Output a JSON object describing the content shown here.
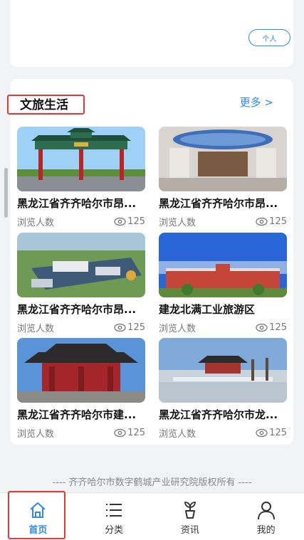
{
  "top_card": {
    "tag_label": "个人"
  },
  "section": {
    "title": "文旅生活",
    "more_label": "更多 >",
    "cards": [
      {
        "title": "黑龙江省齐齐哈尔市昂...",
        "meta_label": "浏览人数",
        "views": "125"
      },
      {
        "title": "黑龙江省齐齐哈尔市昂...",
        "meta_label": "浏览人数",
        "views": "125"
      },
      {
        "title": "黑龙江省齐齐哈尔市昂...",
        "meta_label": "浏览人数",
        "views": "125"
      },
      {
        "title": "建龙北满工业旅游区",
        "meta_label": "浏览人数",
        "views": "125"
      },
      {
        "title": "黑龙江省齐齐哈尔市建...",
        "meta_label": "浏览人数",
        "views": "125"
      },
      {
        "title": "黑龙江省齐齐哈尔市龙...",
        "meta_label": "浏览人数",
        "views": "125"
      }
    ]
  },
  "footer": {
    "copyright": "---- 齐齐哈尔市数字鹤城产业研究院版权所有 ----"
  },
  "nav": {
    "items": [
      {
        "label": "首页",
        "icon": "home-icon",
        "active": true
      },
      {
        "label": "分类",
        "icon": "list-icon",
        "active": false
      },
      {
        "label": "资讯",
        "icon": "plant-icon",
        "active": false
      },
      {
        "label": "我的",
        "icon": "user-icon",
        "active": false
      }
    ]
  },
  "colors": {
    "accent": "#2e8be6",
    "highlight": "#e53935",
    "background": "#f2f3f5"
  }
}
